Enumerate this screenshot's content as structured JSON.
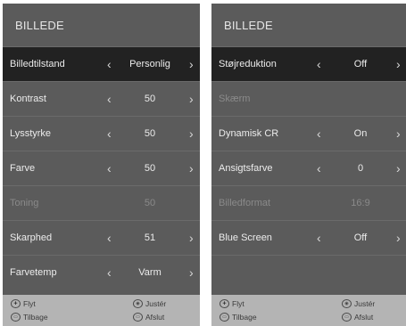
{
  "left": {
    "title": "BILLEDE",
    "rows": [
      {
        "label": "Billedtilstand",
        "value": "Personlig",
        "enabled": true,
        "selected": true
      },
      {
        "label": "Kontrast",
        "value": "50",
        "enabled": true
      },
      {
        "label": "Lysstyrke",
        "value": "50",
        "enabled": true
      },
      {
        "label": "Farve",
        "value": "50",
        "enabled": true
      },
      {
        "label": "Toning",
        "value": "50",
        "enabled": false
      },
      {
        "label": "Skarphed",
        "value": "51",
        "enabled": true
      },
      {
        "label": "Farvetemp",
        "value": "Varm",
        "enabled": true
      }
    ],
    "footer": {
      "move": "Flyt",
      "adjust": "Justér",
      "back": "Tilbage",
      "exit": "Afslut"
    }
  },
  "right": {
    "title": "BILLEDE",
    "rows": [
      {
        "label": "Støjreduktion",
        "value": "Off",
        "enabled": true,
        "selected": true
      },
      {
        "label": "Skærm",
        "value": "",
        "enabled": false
      },
      {
        "label": "Dynamisk CR",
        "value": "On",
        "enabled": true
      },
      {
        "label": "Ansigtsfarve",
        "value": "0",
        "enabled": true
      },
      {
        "label": "Billedformat",
        "value": "16:9",
        "enabled": false
      },
      {
        "label": "Blue Screen",
        "value": "Off",
        "enabled": true
      }
    ],
    "footer": {
      "move": "Flyt",
      "adjust": "Justér",
      "back": "Tilbage",
      "exit": "Afslut"
    }
  },
  "icons": {
    "move": "dpad-icon",
    "adjust": "ok-icon",
    "back": "menu-icon",
    "exit": "exit-icon"
  },
  "colors": {
    "panel": "#5b5b5b",
    "selected_row": "#222222",
    "footer": "#b4b4b4"
  }
}
